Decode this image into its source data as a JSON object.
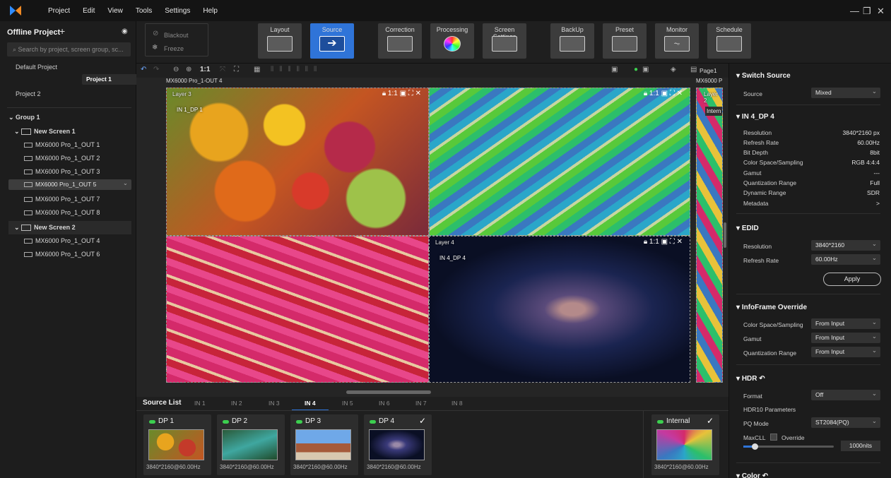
{
  "menus": [
    "Project",
    "Edit",
    "View",
    "Tools",
    "Settings",
    "Help"
  ],
  "toolbar": {
    "blackout": "Blackout",
    "freeze": "Freeze",
    "buttons": [
      "Layout",
      "Source",
      "Correction",
      "Processing",
      "Screen Settings",
      "BackUp",
      "Preset",
      "Monitor",
      "Schedule"
    ]
  },
  "left": {
    "title": "Offline Project",
    "search_placeholder": "Search by project, screen group, sc...",
    "projects": [
      "Default Project",
      "Project 1",
      "Project 2"
    ],
    "group": "Group 1",
    "screen1": "New Screen 1",
    "screen1_outs": [
      "MX6000 Pro_1_OUT 1",
      "MX6000 Pro_1_OUT 2",
      "MX6000 Pro_1_OUT 3",
      "MX6000 Pro_1_OUT 5",
      "MX6000 Pro_1_OUT 7",
      "MX6000 Pro_1_OUT 8"
    ],
    "screen2": "New Screen 2",
    "screen2_outs": [
      "MX6000 Pro_1_OUT 4",
      "MX6000 Pro_1_OUT 6"
    ]
  },
  "canvas": {
    "zoom_label": "1:1",
    "page_label": "Page1",
    "out_label_main": "MX6000 Pro_1-OUT 4",
    "out_label_right": "MX6000 P",
    "layer3": "Layer 3",
    "layer3_src": "IN 1_DP 1",
    "layer4": "Layer 4",
    "layer4_src": "IN 4_DP 4",
    "layer2": "Layer 2",
    "layer2_src": "Intern"
  },
  "right": {
    "switch_source": "Switch Source",
    "source_label": "Source",
    "source_value": "Mixed",
    "input_title": "IN 4_DP 4",
    "info": [
      [
        "Resolution",
        "3840*2160 px"
      ],
      [
        "Refresh Rate",
        "60.00Hz"
      ],
      [
        "Bit Depth",
        "8bit"
      ],
      [
        "Color Space/Sampling",
        "RGB 4:4:4"
      ],
      [
        "Gamut",
        "---"
      ],
      [
        "Quantization Range",
        "Full"
      ],
      [
        "Dynamic Range",
        "SDR"
      ],
      [
        "Metadata",
        ">"
      ]
    ],
    "edid": "EDID",
    "edid_res_label": "Resolution",
    "edid_res": "3840*2160",
    "edid_rate_label": "Refresh Rate",
    "edid_rate": "60.00Hz",
    "apply": "Apply",
    "infoframe": "InfoFrame Override",
    "if_rows": [
      "Color Space/Sampling",
      "Gamut",
      "Quantization Range"
    ],
    "if_value": "From Input",
    "hdr": "HDR",
    "format_label": "Format",
    "format_value": "Off",
    "hdr10": "HDR10 Parameters",
    "pq_label": "PQ Mode",
    "pq_value": "ST2084(PQ)",
    "maxcll": "MaxCLL",
    "override": "Override",
    "nits": "1000nits",
    "color": "Color"
  },
  "bottom": {
    "title": "Source List",
    "tabs": [
      "IN 1",
      "IN 2",
      "IN 3",
      "IN 4",
      "IN 5",
      "IN 6",
      "IN 7",
      "IN 8"
    ],
    "cards": [
      {
        "name": "DP 1",
        "res": "3840*2160@60.00Hz"
      },
      {
        "name": "DP 2",
        "res": "3840*2160@60.00Hz"
      },
      {
        "name": "DP 3",
        "res": "3840*2160@60.00Hz"
      },
      {
        "name": "DP 4",
        "res": "3840*2160@60.00Hz"
      }
    ],
    "internal": {
      "name": "Internal",
      "res": "3840*2160@60.00Hz"
    }
  }
}
